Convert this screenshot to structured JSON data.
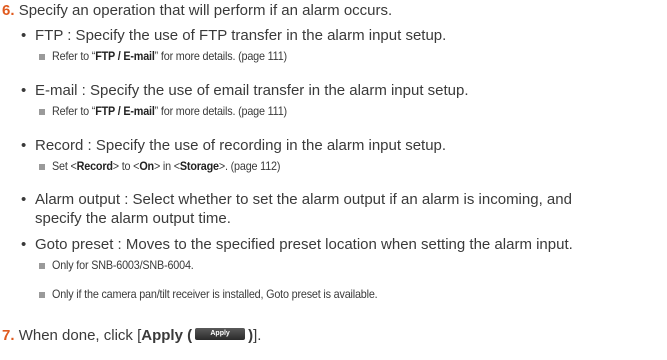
{
  "step6": {
    "number": "6.",
    "text": "Specify an operation that will perform if an alarm occurs."
  },
  "ftp": {
    "text": "FTP : Specify the use of FTP transfer in the alarm input setup.",
    "note_pre": "Refer to “",
    "note_bold": "FTP / E-mail",
    "note_post": "” for more details. (page 111)"
  },
  "email": {
    "text": "E-mail : Specify the use of email transfer in the alarm input setup.",
    "note_pre": "Refer to “",
    "note_bold": "FTP / E-mail",
    "note_post": "” for more details. (page 111)"
  },
  "record": {
    "text": "Record : Specify the use of recording in the alarm input setup.",
    "note_1": "Set <",
    "note_2": "Record",
    "note_3": "> to <",
    "note_4": "On",
    "note_5": "> in <",
    "note_6": "Storage",
    "note_7": ">. (page 112)"
  },
  "alarm_output": {
    "line1": "Alarm output : Select whether to set the alarm output if an alarm is incoming, and",
    "line2": "specify the alarm output time."
  },
  "goto_preset": {
    "text": "Goto preset : Moves to the specified preset location when setting the alarm input.",
    "note1": "Only for SNB-6003/SNB-6004.",
    "note2": "Only if the camera pan/tilt receiver is installed, Goto preset is available."
  },
  "step7": {
    "number": "7.",
    "pre": "When done, click [",
    "bold": "Apply (",
    "button": "Apply",
    "bold_close": ")",
    "post": "]."
  }
}
